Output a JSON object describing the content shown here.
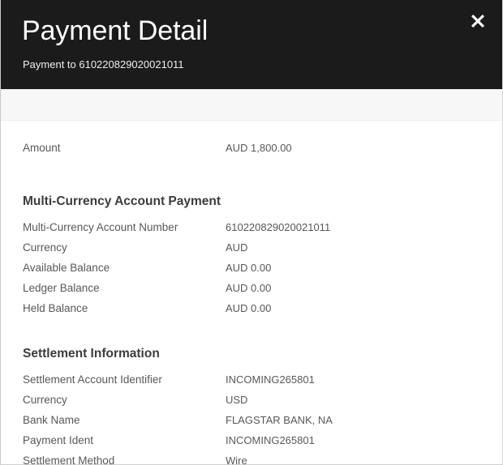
{
  "modal": {
    "title": "Payment Detail",
    "subtitle": "Payment to 610220829020021011",
    "close_icon": "close-icon",
    "colors": {
      "header_background": "#1c1b1b",
      "header_text": "#ffffff",
      "band_background": "#f7f7f7",
      "body_background": "#ffffff",
      "label_text": "#585858",
      "value_text": "#585858",
      "heading_text": "#3c3c3c"
    }
  },
  "amount": {
    "label": "Amount",
    "value": "AUD 1,800.00"
  },
  "sections": [
    {
      "heading": "Multi-Currency Account Payment",
      "rows": [
        {
          "label": "Multi-Currency Account Number",
          "value": "610220829020021011"
        },
        {
          "label": "Currency",
          "value": "AUD"
        },
        {
          "label": "Available Balance",
          "value": "AUD 0.00"
        },
        {
          "label": "Ledger Balance",
          "value": "AUD 0.00"
        },
        {
          "label": "Held Balance",
          "value": "AUD 0.00"
        }
      ]
    },
    {
      "heading": "Settlement Information",
      "rows": [
        {
          "label": "Settlement Account Identifier",
          "value": "INCOMING265801"
        },
        {
          "label": "Currency",
          "value": "USD"
        },
        {
          "label": "Bank Name",
          "value": "FLAGSTAR BANK, NA"
        },
        {
          "label": "Payment Ident",
          "value": "INCOMING265801"
        },
        {
          "label": "Settlement Method",
          "value": "Wire"
        }
      ]
    }
  ]
}
